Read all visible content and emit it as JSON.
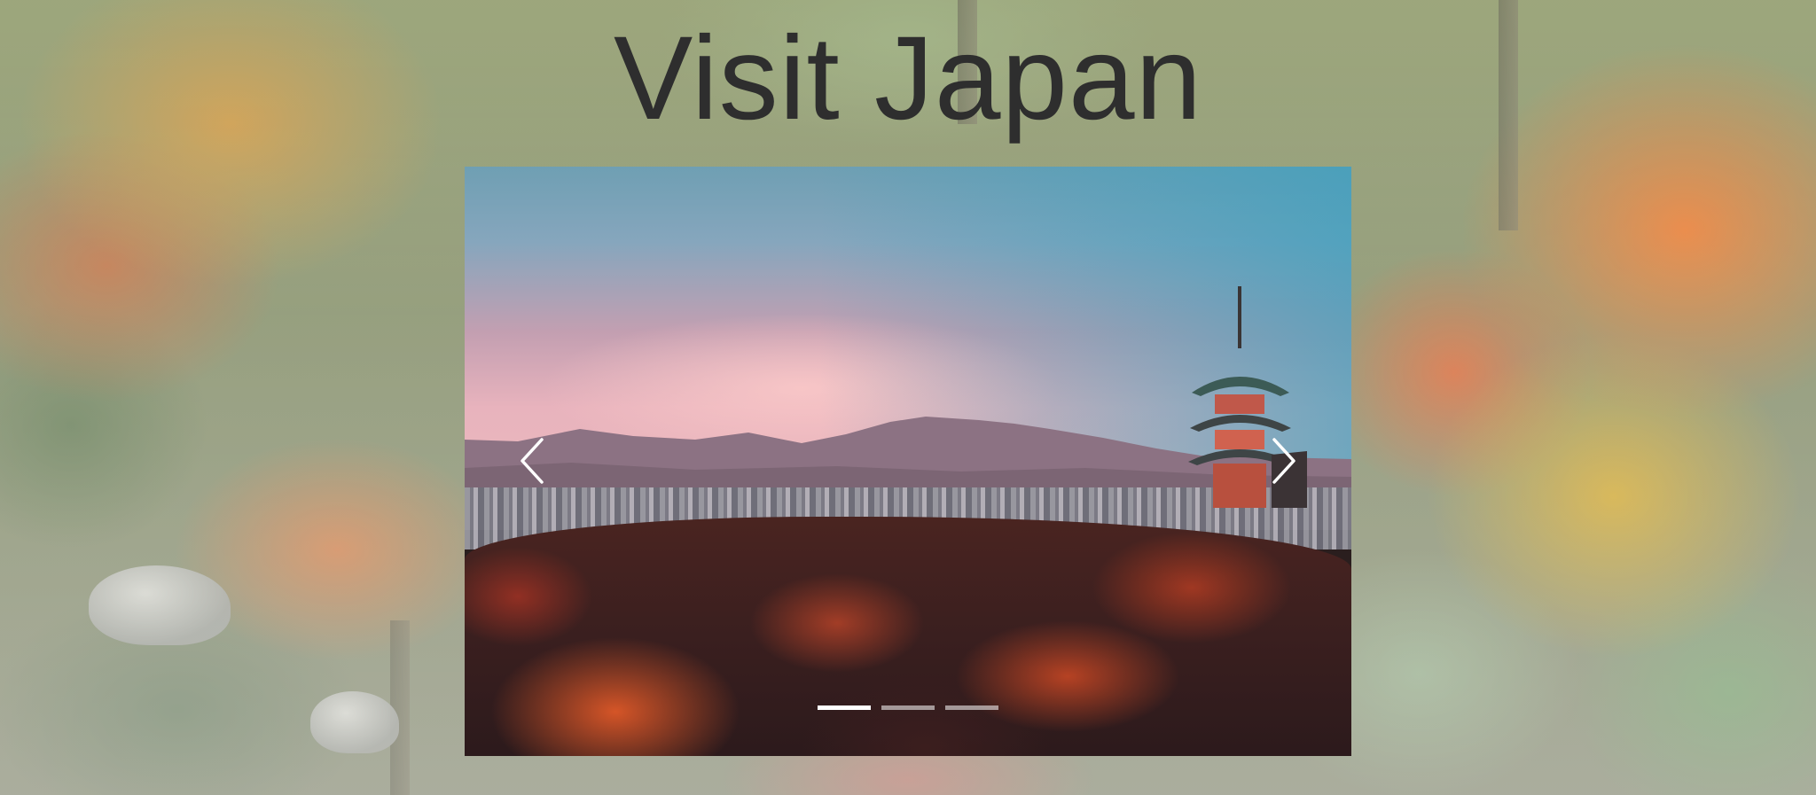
{
  "page": {
    "title": "Visit Japan"
  },
  "background": {
    "image": "autumn-forest-background-image"
  },
  "slideshow": {
    "current_slide": 1,
    "total_slides": 3,
    "slides": [
      {
        "image": "kyoto-pagoda-sunset-image"
      }
    ],
    "prev_icon": "chevron-left-icon",
    "next_icon": "chevron-right-icon",
    "indicators": [
      {
        "active": true
      },
      {
        "active": false
      },
      {
        "active": false
      }
    ]
  },
  "colors": {
    "title": "#2e2e2e",
    "indicator_active": "#ffffff",
    "indicator_inactive": "rgba(255,255,255,0.55)"
  }
}
